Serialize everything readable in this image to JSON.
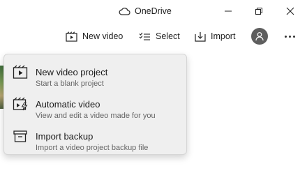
{
  "titlebar": {
    "onedrive_label": "OneDrive"
  },
  "toolbar": {
    "new_video_label": "New video",
    "select_label": "Select",
    "import_label": "Import"
  },
  "menu": {
    "items": [
      {
        "title": "New video project",
        "subtitle": "Start a blank project",
        "icon": "video-project-icon"
      },
      {
        "title": "Automatic video",
        "subtitle": "View and edit a video made for you",
        "icon": "automatic-video-icon"
      },
      {
        "title": "Import backup",
        "subtitle": "Import a video project backup file",
        "icon": "import-backup-icon"
      }
    ]
  }
}
